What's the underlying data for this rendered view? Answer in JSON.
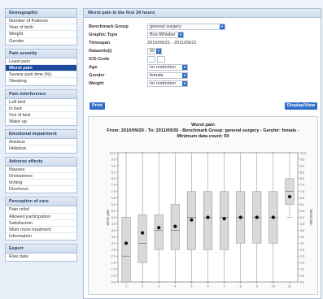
{
  "sidebar": {
    "groups": [
      {
        "title": "Demographic",
        "items": [
          "Number of Patients",
          "Year of birth",
          "Weight",
          "Gender"
        ]
      },
      {
        "title": "Pain severity",
        "items": [
          "Least pain",
          "Worst pain",
          "Severe pain time (%)",
          "Sleeping"
        ],
        "active_index": 1
      },
      {
        "title": "Pain interference",
        "items": [
          "Left bed",
          "In bed",
          "Out of bed",
          "Wake up"
        ]
      },
      {
        "title": "Emotional impairment",
        "items": [
          "Anxious",
          "Helpless"
        ]
      },
      {
        "title": "Adverse effects",
        "items": [
          "Nausea",
          "Drowsiness",
          "Itching",
          "Dizziness"
        ]
      },
      {
        "title": "Perception of care",
        "items": [
          "Pain relief",
          "Allowed participation",
          "Satisfaction",
          "Wish more treatment",
          "Information"
        ]
      },
      {
        "title": "Export",
        "items": [
          "Raw data"
        ]
      }
    ]
  },
  "main": {
    "title": "Worst pain in the first 24 hours",
    "form": {
      "benchmark_group": {
        "label": "Benchmark Group",
        "value": "general surgery"
      },
      "graphic_type": {
        "label": "Graphic Type",
        "value": "Box-Whisker"
      },
      "timespan": {
        "label": "Timespan",
        "value": "2010/09/21 - 2011/09/21"
      },
      "datasets": {
        "label": "Datasets(i)",
        "value": "50"
      },
      "icd_code": {
        "label": "ICD-Code"
      },
      "age": {
        "label": "Age",
        "value": "no restriction"
      },
      "gender": {
        "label": "Gender",
        "value": "female"
      },
      "weight": {
        "label": "Weight",
        "value": "no restriction"
      }
    },
    "print_label": "Print",
    "display_label": "Display/View"
  },
  "chart": {
    "title_line1": "Worst pain",
    "title_line2": "From: 2010/09/20 - To: 2011/09/20 - Benchmark Group: general surgery - Gender: female -",
    "title_line3": "Minimum data count: 50",
    "ylabel_left": "Worst pain",
    "ylabel_right": "Worst pain"
  },
  "chart_data": {
    "type": "box",
    "categories": [
      "1",
      "2",
      "3",
      "4",
      "5",
      "6",
      "7",
      "8",
      "9",
      "10",
      "11"
    ],
    "ylim": [
      0,
      10
    ],
    "yticks": [
      "0.0",
      "0.5",
      "1.0",
      "1.5",
      "2.0",
      "2.5",
      "3.0",
      "3.5",
      "4.0",
      "4.5",
      "5.0",
      "5.5",
      "6.0",
      "6.5",
      "7.0",
      "7.5",
      "8.0",
      "8.5",
      "9.0",
      "9.5",
      "10.0"
    ],
    "boxes": [
      {
        "min": 0,
        "q1": 0,
        "median": 2,
        "q3": 5,
        "max": 10,
        "mean": 3.0
      },
      {
        "min": 0,
        "q1": 1.5,
        "median": 3,
        "q3": 5.2,
        "max": 10,
        "mean": 3.8
      },
      {
        "min": 0,
        "q1": 2.5,
        "median": 4,
        "q3": 5.2,
        "max": 10,
        "mean": 4.2
      },
      {
        "min": 0,
        "q1": 2.5,
        "median": 4,
        "q3": 6,
        "max": 10,
        "mean": 4.3
      },
      {
        "min": 0,
        "q1": 2.5,
        "median": 5,
        "q3": 7,
        "max": 10,
        "mean": 4.8
      },
      {
        "min": 0,
        "q1": 2.5,
        "median": 5,
        "q3": 7,
        "max": 10,
        "mean": 5.0
      },
      {
        "min": 0,
        "q1": 2.5,
        "median": 5,
        "q3": 7,
        "max": 10,
        "mean": 4.9
      },
      {
        "min": 0,
        "q1": 3,
        "median": 5,
        "q3": 7,
        "max": 10,
        "mean": 5.0
      },
      {
        "min": 0,
        "q1": 3,
        "median": 5,
        "q3": 7,
        "max": 10,
        "mean": 5.0
      },
      {
        "min": 0,
        "q1": 3,
        "median": 5,
        "q3": 7,
        "max": 10,
        "mean": 5.0
      },
      {
        "min": 5,
        "q1": 6,
        "median": 7,
        "q3": 8,
        "max": 10,
        "mean": 6.6
      }
    ],
    "grid": false
  }
}
